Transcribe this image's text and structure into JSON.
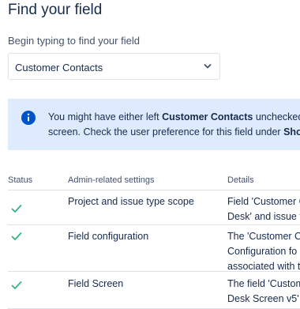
{
  "page": {
    "title": "Find your field"
  },
  "field_search": {
    "label": "Begin typing to find your field",
    "selected_value": "Customer Contacts"
  },
  "banner": {
    "line1_prefix": "You might have either left ",
    "line1_bold": "Customer Contacts",
    "line1_suffix": " unchecked",
    "line2_prefix": "screen. Check the user preference for this field under ",
    "line2_bold": "Sho"
  },
  "table": {
    "headers": {
      "status": "Status",
      "settings": "Admin-related settings",
      "details": "Details"
    },
    "rows": [
      {
        "status": "ok",
        "setting": "Project and issue type scope",
        "details_line1": "Field 'Customer C",
        "details_line2": "Desk' and issue t"
      },
      {
        "status": "ok",
        "setting": "Field configuration",
        "details_line1": "The 'Customer C",
        "details_line2": "Configuration fo",
        "details_line3": "associated with t"
      },
      {
        "status": "ok",
        "setting": "Field Screen",
        "details_line1": "The field 'Custom",
        "details_line2": "Desk Screen v5' c"
      }
    ]
  },
  "colors": {
    "info": "#0052cc",
    "success": "#36b37e",
    "banner_bg": "#deebff"
  }
}
